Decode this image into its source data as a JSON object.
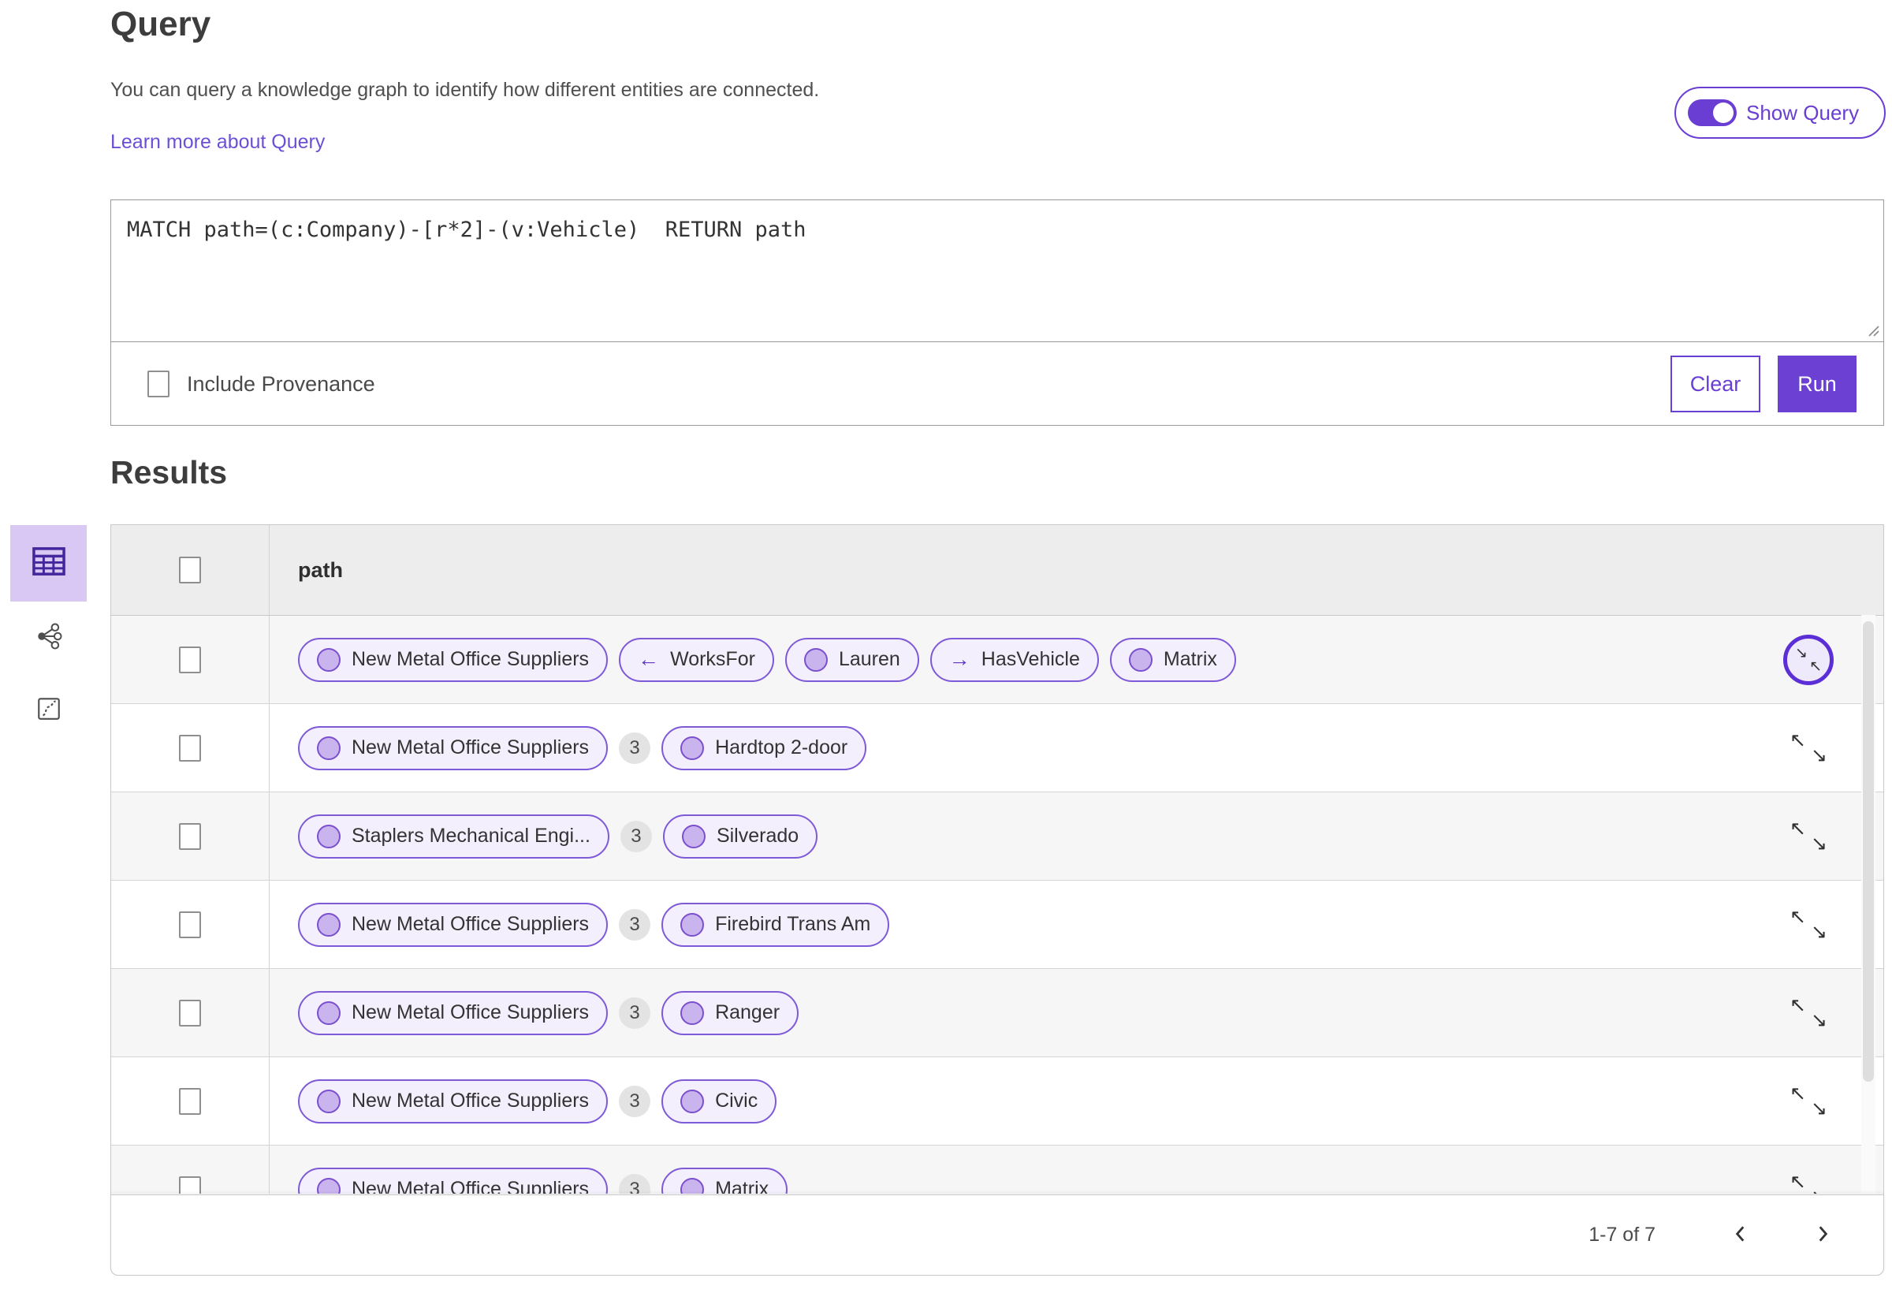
{
  "header": {
    "title": "Query",
    "description": "You can query a knowledge graph to identify how different entities are connected.",
    "learn_more_label": "Learn more about Query",
    "show_query_label": "Show Query",
    "show_query_toggle_state": "on"
  },
  "query_panel": {
    "query_text": "MATCH path=(c:Company)-[r*2]-(v:Vehicle)  RETURN path",
    "include_provenance_label": "Include Provenance",
    "include_provenance_checked": false,
    "clear_label": "Clear",
    "run_label": "Run"
  },
  "results": {
    "title": "Results",
    "column_header": "path",
    "view_rail_icons": [
      "table-view-icon",
      "link-chart-view-icon",
      "map-view-icon"
    ],
    "selected_view": "table-view",
    "select_all_checked": false,
    "rows": [
      {
        "expand_state": "collapse",
        "cells": [
          {
            "kind": "entity",
            "label": "New Metal Office Suppliers"
          },
          {
            "kind": "rel",
            "arrow": "←",
            "label": "WorksFor"
          },
          {
            "kind": "entity",
            "label": "Lauren"
          },
          {
            "kind": "rel",
            "arrow": "→",
            "label": "HasVehicle"
          },
          {
            "kind": "entity",
            "label": "Matrix"
          }
        ]
      },
      {
        "expand_state": "expand",
        "cells": [
          {
            "kind": "entity",
            "label": "New Metal Office Suppliers"
          },
          {
            "kind": "count",
            "label": "3"
          },
          {
            "kind": "entity",
            "label": "Hardtop 2-door"
          }
        ]
      },
      {
        "expand_state": "expand",
        "cells": [
          {
            "kind": "entity",
            "label": "Staplers Mechanical Engi..."
          },
          {
            "kind": "count",
            "label": "3"
          },
          {
            "kind": "entity",
            "label": "Silverado"
          }
        ]
      },
      {
        "expand_state": "expand",
        "cells": [
          {
            "kind": "entity",
            "label": "New Metal Office Suppliers"
          },
          {
            "kind": "count",
            "label": "3"
          },
          {
            "kind": "entity",
            "label": "Firebird Trans Am"
          }
        ]
      },
      {
        "expand_state": "expand",
        "cells": [
          {
            "kind": "entity",
            "label": "New Metal Office Suppliers"
          },
          {
            "kind": "count",
            "label": "3"
          },
          {
            "kind": "entity",
            "label": "Ranger"
          }
        ]
      },
      {
        "expand_state": "expand",
        "cells": [
          {
            "kind": "entity",
            "label": "New Metal Office Suppliers"
          },
          {
            "kind": "count",
            "label": "3"
          },
          {
            "kind": "entity",
            "label": "Civic"
          }
        ]
      },
      {
        "expand_state": "expand",
        "cells": [
          {
            "kind": "entity",
            "label": "New Metal Office Suppliers"
          },
          {
            "kind": "count",
            "label": "3"
          },
          {
            "kind": "entity",
            "label": "Matrix"
          }
        ]
      }
    ],
    "pagination": {
      "range_label": "1-7 of 7",
      "prev_icon": "chevron-left",
      "next_icon": "chevron-right"
    }
  },
  "colors": {
    "accent": "#6a3ed2",
    "accent_dark": "#5b2fd5",
    "run_button_bg": "#6b40d2",
    "pill_bg": "#f3effc",
    "pill_border": "#7e59d8",
    "entity_dot_fill": "#c9b4ee",
    "selected_view_bg": "#d9c7f4",
    "table_header_bg": "#ededed",
    "row_alt_bg": "#f6f6f6",
    "count_badge_bg": "#e3e3e3",
    "link_color": "#6c4fd6"
  }
}
